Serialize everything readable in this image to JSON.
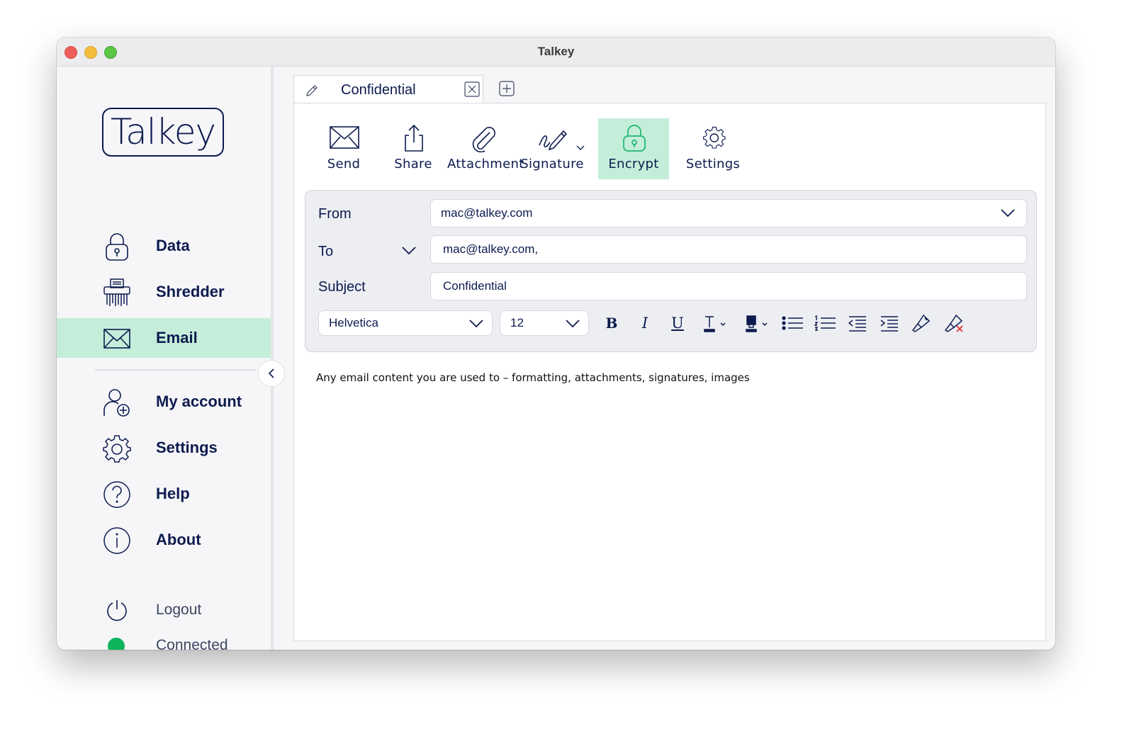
{
  "window": {
    "title": "Talkey"
  },
  "sidebar": {
    "logo_text": "Talkey",
    "items": [
      {
        "label": "Data",
        "icon": "lock-icon"
      },
      {
        "label": "Shredder",
        "icon": "shredder-icon"
      },
      {
        "label": "Email",
        "icon": "envelope-icon",
        "active": true
      },
      {
        "label": "My account",
        "icon": "user-add-icon"
      },
      {
        "label": "Settings",
        "icon": "gear-icon"
      },
      {
        "label": "Help",
        "icon": "question-icon"
      },
      {
        "label": "About",
        "icon": "info-icon"
      }
    ],
    "logout_label": "Logout",
    "status_label": "Connected",
    "status_color": "#0db45c"
  },
  "tab": {
    "label": "Confidential"
  },
  "toolbar": {
    "send": "Send",
    "share": "Share",
    "attachment": "Attachment",
    "signature": "Signature",
    "encrypt": "Encrypt",
    "settings": "Settings"
  },
  "compose": {
    "from_label": "From",
    "from_value": "mac@talkey.com",
    "to_label": "To",
    "to_value": "mac@talkey.com,",
    "subject_label": "Subject",
    "subject_value": "Confidential"
  },
  "format": {
    "font": "Helvetica",
    "size": "12",
    "bold": "B",
    "italic": "I",
    "underline": "U"
  },
  "body": {
    "text": "Any email content you are used to – formatting, attachments, signatures, images"
  },
  "colors": {
    "accent": "#c4eed9",
    "navy": "#0d1b4f",
    "encrypt_green": "#1fb56e"
  }
}
